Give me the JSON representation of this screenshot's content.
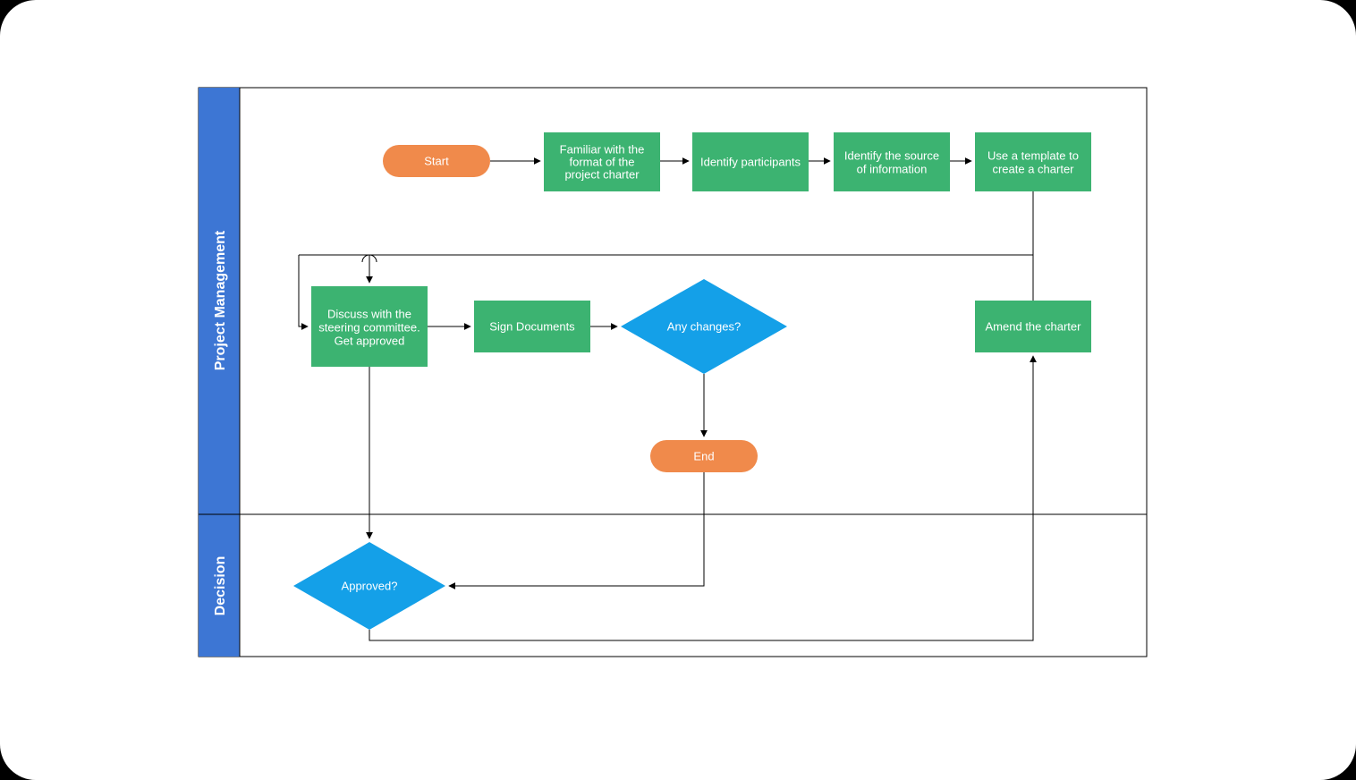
{
  "colors": {
    "laneHeader": "#3d76d4",
    "process": "#3cb371",
    "terminator": "#f08a4b",
    "decision": "#14a0e8",
    "border": "#000000"
  },
  "lanes": {
    "lane1": "Project Management",
    "lane2": "Decision"
  },
  "nodes": {
    "start": "Start",
    "familiar": "Familiar with the format of the project charter",
    "identifyParticipants": "Identify participants",
    "identifySource": "Identify the source of information",
    "useTemplate": "Use a template to create a charter",
    "discuss1": "Discuss with the",
    "discuss2": "steering committee.",
    "discuss3": "Get approved",
    "sign": "Sign Documents",
    "anyChanges": "Any changes?",
    "amend": "Amend the charter",
    "end": "End",
    "approved": "Approved?"
  }
}
